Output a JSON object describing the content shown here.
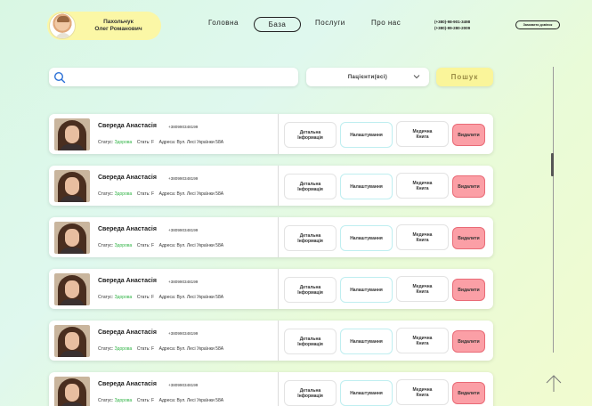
{
  "header": {
    "user_name": "Пахольчук\nОлег Романович",
    "nav": {
      "home": "Головна",
      "base": "База",
      "services": "Послуги",
      "about": "Про нас"
    },
    "phones": [
      "(+380)-98-901-3498",
      "(+380)-99-280-2009"
    ],
    "callback_label": "Замовити дзвінок"
  },
  "search": {
    "placeholder": "",
    "value": ""
  },
  "filter": {
    "selected": "Пацієнти(всі)"
  },
  "search_button": "Пошук",
  "patients": [
    {
      "name": "Свереда Анастасія",
      "phone": "+380990348199",
      "status_label": "Статус:",
      "status": "Здорова",
      "sex_label": "Стать:",
      "sex": "F",
      "address_label": "Адреса:",
      "address": "Вул. Лесі Українки 58А"
    },
    {
      "name": "Свереда Анастасія",
      "phone": "+380990348199",
      "status_label": "Статус:",
      "status": "Здорова",
      "sex_label": "Стать:",
      "sex": "F",
      "address_label": "Адреса:",
      "address": "Вул. Лесі Українки 58А"
    },
    {
      "name": "Свереда Анастасія",
      "phone": "+380990348199",
      "status_label": "Статус:",
      "status": "Здорова",
      "sex_label": "Стать:",
      "sex": "F",
      "address_label": "Адреса:",
      "address": "Вул. Лесі Українки 58А"
    },
    {
      "name": "Свереда Анастасія",
      "phone": "+380990348199",
      "status_label": "Статус:",
      "status": "Здорова",
      "sex_label": "Стать:",
      "sex": "F",
      "address_label": "Адреса:",
      "address": "Вул. Лесі Українки 58А"
    },
    {
      "name": "Свереда Анастасія",
      "phone": "+380990348199",
      "status_label": "Статус:",
      "status": "Здорова",
      "sex_label": "Стать:",
      "sex": "F",
      "address_label": "Адреса:",
      "address": "Вул. Лесі Українки 58А"
    },
    {
      "name": "Свереда Анастасія",
      "phone": "+380990348199",
      "status_label": "Статус:",
      "status": "Здорова",
      "sex_label": "Стать:",
      "sex": "F",
      "address_label": "Адреса:",
      "address": "Вул. Лесі Українки 58А"
    }
  ],
  "row_actions": {
    "details": "Детальна\nІнформація",
    "settings": "Налаштування",
    "medbook": "Медична\nКнига",
    "delete": "Видалити"
  },
  "colors": {
    "accent_yellow": "#faf59a",
    "status_green": "#2fb344",
    "delete_red": "#fb9fa6"
  },
  "icons": {
    "search": "search-icon",
    "dropdown": "chevron-down-icon",
    "scroll_top": "arrow-up-icon"
  }
}
